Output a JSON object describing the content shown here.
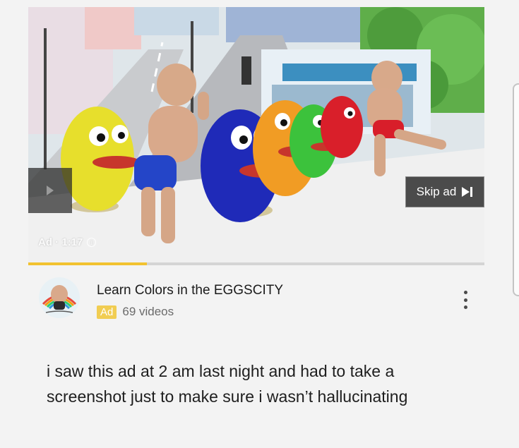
{
  "player": {
    "skip_label": "Skip ad",
    "ad_label": "Ad · 1:17",
    "progress_fraction": 0.26,
    "accent_color": "#f2c230"
  },
  "channel": {
    "title": "Learn Colors in the EGGSCITY",
    "badge": "Ad",
    "video_count": "69 videos"
  },
  "caption": "i saw this ad at 2 am last night and had to take a screenshot just to make sure i wasn’t hallucinating",
  "icons": [
    "play-prev-icon",
    "skip-next-icon",
    "info-icon",
    "more-vert-icon"
  ]
}
